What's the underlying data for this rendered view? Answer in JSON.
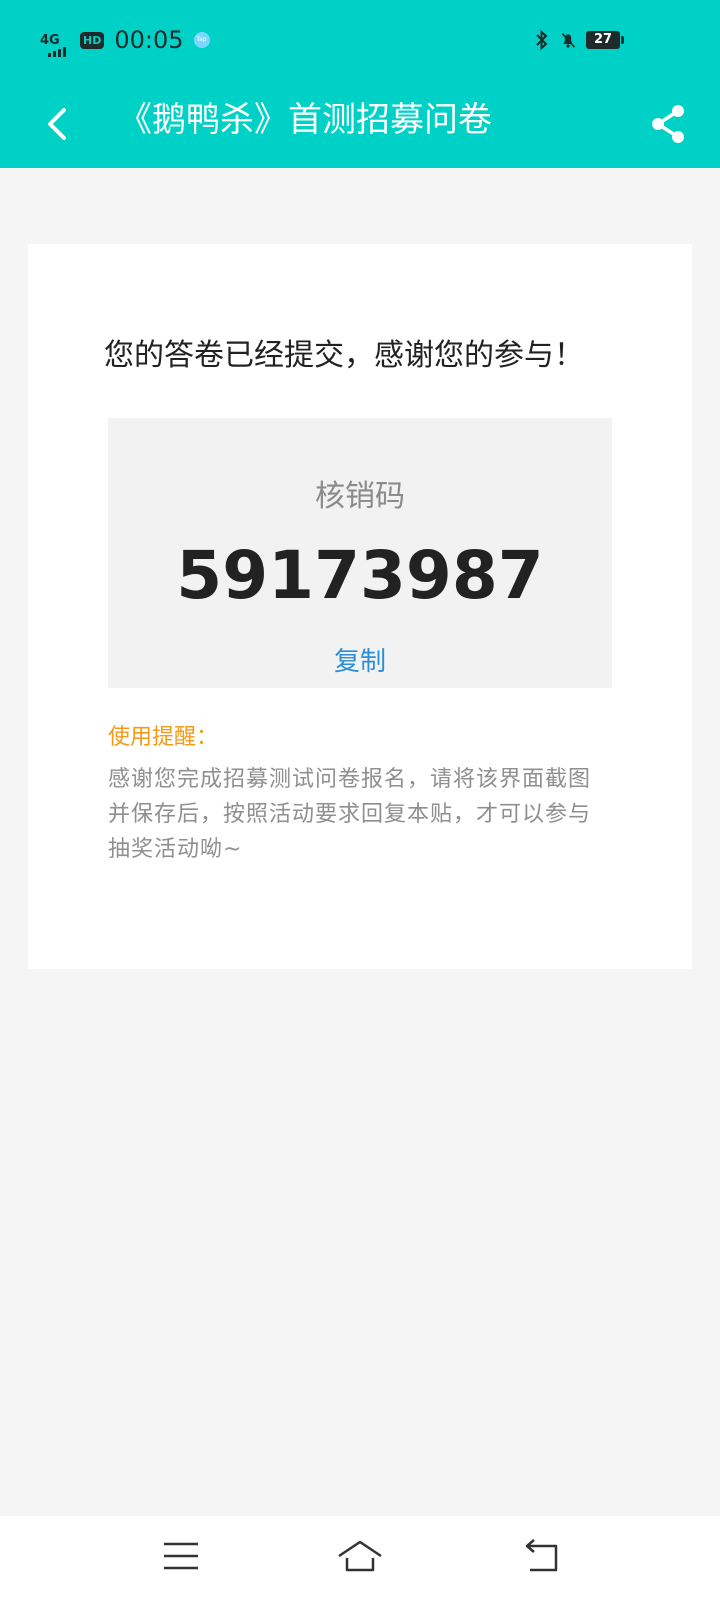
{
  "status_bar": {
    "network": "4G",
    "hd": "HD",
    "time": "00:05",
    "app_badge": "Tap",
    "battery": "27"
  },
  "header": {
    "title": "《鹅鸭杀》首测招募问卷",
    "back_icon": "chevron-left-icon",
    "share_icon": "share-icon",
    "color": "#00d1c6"
  },
  "card": {
    "message": "您的答卷已经提交，感谢您的参与！",
    "code_label": "核销码",
    "code_value": "59173987",
    "copy_label": "复制",
    "reminder_title": "使用提醒：",
    "reminder_text": "感谢您完成招募测试问卷报名，请将该界面截图并保存后，按照活动要求回复本贴，才可以参与抽奖活动呦~"
  },
  "nav": {
    "menu_icon": "menu-icon",
    "home_icon": "home-icon",
    "back_icon": "back-icon"
  },
  "colors": {
    "accent": "#00d1c6",
    "link": "#2b8fd8",
    "warning": "#f39a16"
  }
}
